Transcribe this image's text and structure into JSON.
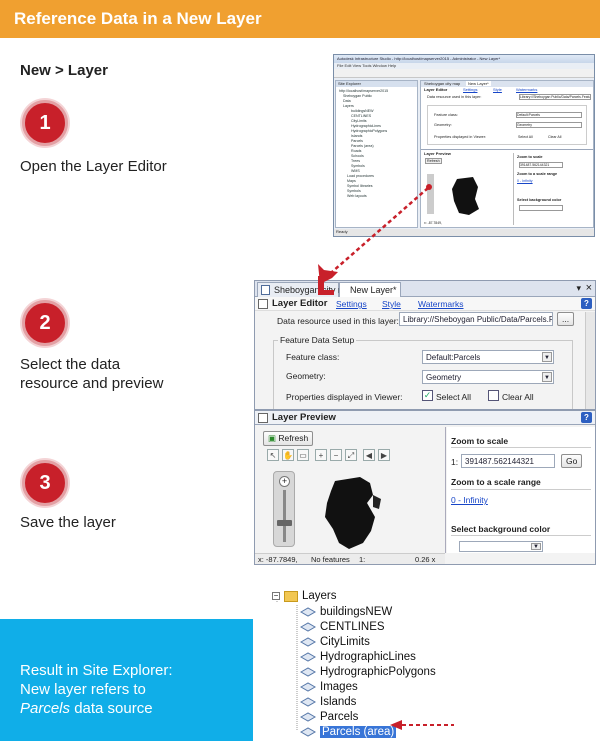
{
  "banner": {
    "title": "Reference Data in a New Layer"
  },
  "menu_path": "New > Layer",
  "steps": [
    {
      "number": "1",
      "text": "Open the Layer Editor"
    },
    {
      "number": "2",
      "text_line1": "Select the data",
      "text_line2": "resource and preview"
    },
    {
      "number": "3",
      "text": "Save the layer"
    }
  ],
  "result": {
    "line1": "Result in Site Explorer:",
    "line2": "New layer refers to",
    "line3_italic": "Parcels",
    "line3_rest": " data source"
  },
  "shot1": {
    "title": "Autodesk Infrastructure Studio - http://localhost/mapserver2015 - Administrator - New Layer*",
    "menu": "File   Edit   View   Tools   Window   Help",
    "site_explorer": "Site Explorer",
    "tree": [
      "http://localhost/mapserver2015",
      "Sheboygan Public",
      "Data",
      "Layers",
      "buildingsNEW",
      "CENTLINES",
      "CityLimits",
      "HydrographicLines",
      "HydrographicPolygons",
      "Islands",
      "Parcels",
      "Parcels (area)",
      "Roads",
      "Schools",
      "Trees",
      "Symbols",
      "WMS",
      "Load procedures",
      "Maps",
      "Symbol libraries",
      "Symbols",
      "Web layouts"
    ],
    "tab1": "Sheboygan city map",
    "tab2": "New Layer*",
    "layer_editor": "Layer Editor",
    "settings": "Settings",
    "style": "Style",
    "watermarks": "Watermarks",
    "data_resource_label": "Data resource used in this layer:",
    "data_resource_value": "Library://Sheboygan Public/Data/Parcels.Feature",
    "feature_class": "Feature class:",
    "feature_class_value": "Default:Parcels",
    "geometry": "Geometry:",
    "geometry_value": "Geometry",
    "properties": "Properties displayed in Viewer:",
    "select_all": "Select All",
    "clear_all": "Clear All",
    "layer_preview": "Layer Preview",
    "refresh": "Refresh",
    "zoom_to_scale": "Zoom to scale",
    "scale_value": "391487.562144321",
    "zoom_range": "Zoom to a scale range",
    "range_value": "0 - Infinity",
    "bg_color": "Select background color",
    "status_coords": "x: -87.7849,",
    "status_ready": "Ready"
  },
  "shot2": {
    "tab1": "Sheboygan city m",
    "tab2": "New Layer*",
    "pin": "▾",
    "close": "×",
    "layer_editor": "Layer Editor",
    "settings": "Settings",
    "style": "Style",
    "watermarks": "Watermarks",
    "data_resource_label": "Data resource used in this layer:",
    "data_resource_value": "Library://Sheboygan Public/Data/Parcels.FeatureS",
    "browse": "...",
    "group_title": "Feature Data Setup",
    "feature_class": "Feature class:",
    "feature_class_value": "Default:Parcels",
    "geometry": "Geometry:",
    "geometry_value": "Geometry",
    "properties": "Properties displayed in Viewer:",
    "select_all": "Select All",
    "clear_all": "Clear All"
  },
  "shot3": {
    "layer_preview": "Layer Preview",
    "refresh": "Refresh",
    "zoom_to_scale": "Zoom to scale",
    "scale_prefix": "1:",
    "scale_value": "391487.562144321",
    "go": "Go",
    "zoom_range": "Zoom to a scale range",
    "range_value": "0 - Infinity",
    "bg_color": "Select background color",
    "status_coords": "x: -87.7849,",
    "status_features": "No features",
    "status_scale": "1:",
    "status_size": "0.26 x"
  },
  "tree": {
    "root": "Layers",
    "items": [
      "buildingsNEW",
      "CENTLINES",
      "CityLimits",
      "HydrographicLines",
      "HydrographicPolygons",
      "Images",
      "Islands",
      "Parcels",
      "Parcels (area)"
    ]
  },
  "colors": {
    "banner": "#f0a030",
    "step_circle": "#c8202a",
    "result_box": "#10aee8",
    "arrow": "#c8202a",
    "selection": "#3875d7"
  }
}
